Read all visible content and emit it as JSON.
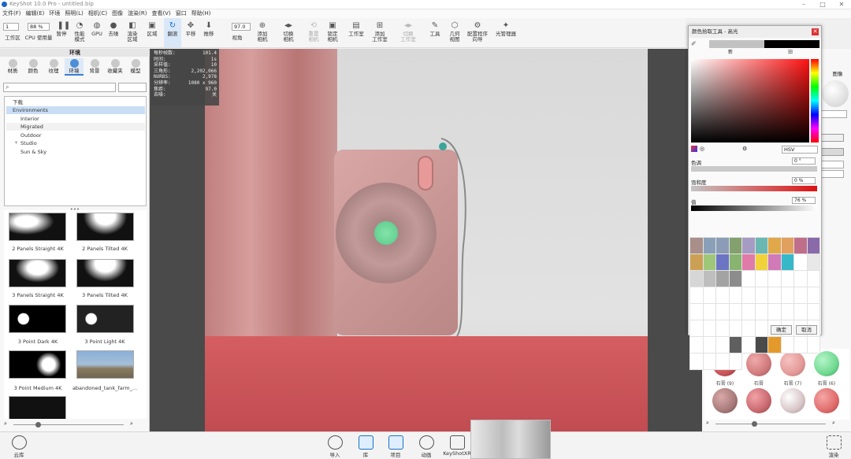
{
  "window": {
    "title": "KeyShot 10.0 Pro - untitled.bip"
  },
  "menu": [
    "文件(F)",
    "编辑(E)",
    "环境",
    "照明(L)",
    "相机(C)",
    "图像",
    "渲染(R)",
    "查看(V)",
    "窗口",
    "帮助(H)"
  ],
  "toolbar": {
    "workspace_value": "1",
    "cpu_value": "88 %",
    "workspace_label": "工作区",
    "cpu_label": "CPU 使用量",
    "pause_label": "暂停",
    "perf_label": "性能\n模式",
    "gpu_label": "GPU",
    "denoise_label": "去噪",
    "region_label": "渲染\n区域",
    "regionb_label": "区域",
    "tumble_label": "翻滚",
    "pan_label": "平移",
    "dolly_label": "推移",
    "fov_value": "97.0",
    "perspective_label": "视角",
    "add_camera_label": "添加\n相机",
    "switch_camera_label": "切换\n相机",
    "reset_camera_label": "重置\n相机",
    "lock_camera_label": "锁定\n相机",
    "studio_label": "工作室",
    "add_studio_label": "添加\n工作室",
    "switch_studio_label": "切换\n工作室",
    "tools_label": "工具",
    "geometry_label": "几何\n视图",
    "config_label": "配置程序\n向导",
    "light_label": "光管理器"
  },
  "left_panel": {
    "title": "环境",
    "tabs": [
      "材质",
      "颜色",
      "纹理",
      "环境",
      "背景",
      "收藏夹",
      "模型"
    ],
    "selected_tab": "环境",
    "tree": [
      {
        "label": "下载",
        "indent": 1
      },
      {
        "label": "Environments",
        "indent": 1,
        "selected": true
      },
      {
        "label": "Interior",
        "indent": 3
      },
      {
        "label": "Migrated",
        "indent": 3
      },
      {
        "label": "Outdoor",
        "indent": 3
      },
      {
        "label": "Studio",
        "indent": 3,
        "expandable": true
      },
      {
        "label": "Sun & Sky",
        "indent": 3
      }
    ],
    "thumbnails": [
      "2 Panels Straight 4K",
      "2 Panels Tilted 4K",
      "3 Panels Straight 4K",
      "3 Panels Tilted 4K",
      "3 Point Dark 4K",
      "3 Point Light 4K",
      "3 Point Medium 4K",
      "abandoned_tank_farm_..."
    ]
  },
  "viewport_stats": [
    {
      "label": "每秒帧数:",
      "value": "101.4"
    },
    {
      "label": "时间:",
      "value": "1s"
    },
    {
      "label": "采样值:",
      "value": "10"
    },
    {
      "label": "三角形:",
      "value": "2,202,066"
    },
    {
      "label": "NURBS:",
      "value": "2,978"
    },
    {
      "label": "分辨率:",
      "value": "1080 x 960"
    },
    {
      "label": "焦距:",
      "value": "97.0"
    },
    {
      "label": "去噪:",
      "value": "关"
    }
  ],
  "color_picker": {
    "title": "颜色拾取工具 - 高光",
    "new_label": "新",
    "old_label": "旧",
    "mode_value": "HSV",
    "hue_label": "色调",
    "hue_value": "0 °",
    "sat_label": "饱和度",
    "sat_value": "0 %",
    "val_label": "值",
    "val_value": "76 %",
    "ok_label": "确定",
    "cancel_label": "取消",
    "swatches": [
      "#a88f8a",
      "#8aa0b8",
      "#8c9cb6",
      "#83a06e",
      "#a69bc2",
      "#6bb7b2",
      "#e0a84a",
      "#e1a05e",
      "#c06f8a",
      "#8a6aa8",
      "#cba055",
      "#9fc77a",
      "#6b75c3",
      "#88b470",
      "#e07aa8",
      "#f1d23a",
      "#d07bb7",
      "#36b8c8",
      "#ffffff",
      "#e8e8e8",
      "#d6d6d6",
      "#bebebe",
      "#a3a3a3",
      "#8c8c8c",
      "#ffffff",
      "#ffffff",
      "#ffffff",
      "#ffffff",
      "#ffffff",
      "#ffffff",
      "#ffffff",
      "#ffffff",
      "#ffffff",
      "#ffffff",
      "#ffffff",
      "#ffffff",
      "#ffffff",
      "#ffffff",
      "#ffffff",
      "#ffffff",
      "#ffffff",
      "#ffffff",
      "#ffffff",
      "#ffffff",
      "#ffffff",
      "#ffffff",
      "#ffffff",
      "#ffffff",
      "#ffffff",
      "#ffffff",
      "#ffffff",
      "#ffffff",
      "#ffffff",
      "#ffffff",
      "#ffffff",
      "#ffffff",
      "#ffffff",
      "#ffffff",
      "#ffffff",
      "#ffffff",
      "#ffffff",
      "#ffffff",
      "#ffffff",
      "#5f5f5f",
      "#ffffff",
      "#4a4a4a",
      "#e49a2b",
      "#ffffff",
      "#ffffff",
      "#ffffff",
      "#ffffff",
      "#ffffff",
      "#ffffff",
      "#ffffff"
    ]
  },
  "right_panel": {
    "image_label": "图像",
    "materials": [
      {
        "label": "石膏 (9)",
        "color": "#c75458"
      },
      {
        "label": "石膏",
        "color": "#d07a7c"
      },
      {
        "label": "石膏 (7)",
        "color": "#e39a98"
      },
      {
        "label": "石膏 (6)",
        "color": "#70d991"
      },
      {
        "label": "",
        "color": "#a87a7a"
      },
      {
        "label": "",
        "color": "#c96a70"
      },
      {
        "label": "",
        "color": "#d8c6c8"
      },
      {
        "label": "",
        "color": "#e06c6c"
      }
    ]
  },
  "bottom_bar": {
    "cloud_label": "云库",
    "import_label": "导入",
    "library_label": "库",
    "project_label": "项目",
    "animation_label": "动画",
    "keyshotxr_label": "KeyShotXR",
    "render_label": "渲染"
  }
}
